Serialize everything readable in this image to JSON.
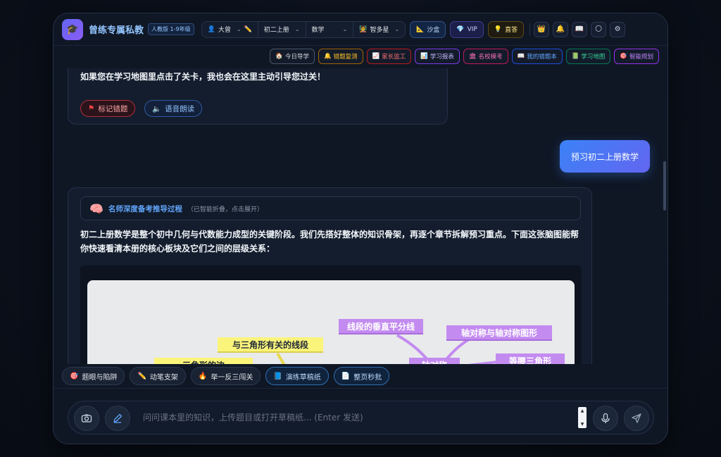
{
  "header": {
    "title": "曾练专属私教",
    "edition": "人教版 1-9年级",
    "persona": "大曾",
    "grade": "初二上册",
    "subject": "数学",
    "teacher": "智多星",
    "sandbox_label": "沙盒",
    "vip_label": "VIP",
    "qa_label": "直答"
  },
  "toolbar": [
    {
      "icon": "🏠",
      "label": "今日导学",
      "color": "#d1d5db",
      "border": "#4b5563"
    },
    {
      "icon": "🔔",
      "label": "错题复测",
      "color": "#fbbf24",
      "border": "#a16207"
    },
    {
      "icon": "📈",
      "label": "家长监工",
      "color": "#f87171",
      "border": "#b91c1c"
    },
    {
      "icon": "📊",
      "label": "学习报表",
      "color": "#c4b5fd",
      "border": "#7c3aed"
    },
    {
      "icon": "🏛",
      "label": "名校模考",
      "color": "#f472b6",
      "border": "#be185d"
    },
    {
      "icon": "📖",
      "label": "我的错题本",
      "color": "#60a5fa",
      "border": "#1d4ed8"
    },
    {
      "icon": "📗",
      "label": "学习地图",
      "color": "#34d399",
      "border": "#047857"
    },
    {
      "icon": "🎯",
      "label": "智能规划",
      "color": "#c084fc",
      "border": "#9333ea"
    }
  ],
  "chat": {
    "prev_ai_text": "如果您在学习地图里点击了关卡，我也会在这里主动引导您过关！",
    "mark_wrong_label": "标记错题",
    "read_aloud_label": "语音朗读",
    "user_message": "预习初二上册数学",
    "reasoning_title": "名师深度备考推导过程",
    "reasoning_hint": "（已智能折叠，点击展开）",
    "ai_text": "初二上册数学是整个初中几何与代数能力成型的关键阶段。我们先搭好整体的知识骨架，再逐个章节拆解预习重点。下面这张脑图能帮你快速看清本册的核心板块及它们之间的层级关系：",
    "mindmap_nodes": [
      {
        "label": "线段的垂直平分线",
        "style": "purple"
      },
      {
        "label": "轴对称与轴对称图形",
        "style": "purple"
      },
      {
        "label": "与三角形有关的线段",
        "style": "yellow"
      },
      {
        "label": "等腰三角形",
        "style": "purple"
      },
      {
        "label": "轴对称",
        "style": "purple"
      },
      {
        "label": "三角形的边",
        "style": "yellow"
      }
    ]
  },
  "quick_actions": [
    {
      "icon": "🎯",
      "label": "题眼与陷阱",
      "highlight": false
    },
    {
      "icon": "✏️",
      "label": "动笔支架",
      "highlight": false
    },
    {
      "icon": "🔥",
      "label": "举一反三闯关",
      "highlight": false
    },
    {
      "icon": "📘",
      "label": "演练草稿纸",
      "highlight": true
    },
    {
      "icon": "📄",
      "label": "整页秒批",
      "highlight": true
    }
  ],
  "composer": {
    "placeholder": "问问课本里的知识，上传题目或打开草稿纸... (Enter 发送)"
  }
}
